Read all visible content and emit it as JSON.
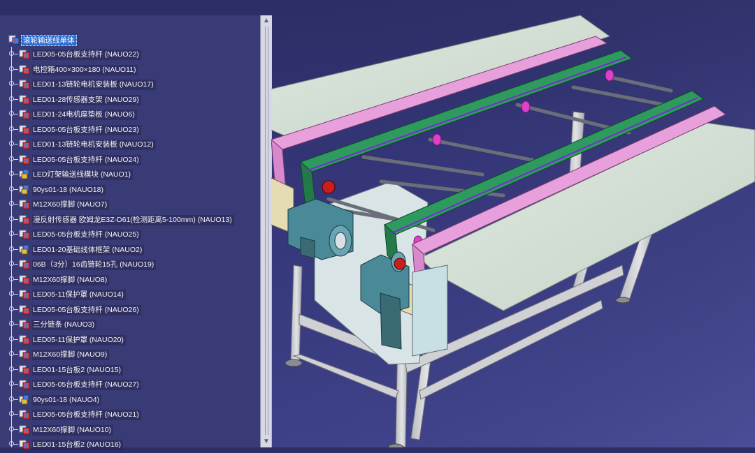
{
  "tree": {
    "root": {
      "label": "滚轮输送线单体",
      "icon": "product-icon"
    },
    "items": [
      {
        "label": "LED05-05台板支持杆 (NAUO22)",
        "icon": "part-icon"
      },
      {
        "label": "电控箱400×300×180 (NAUO11)",
        "icon": "part-icon"
      },
      {
        "label": "LED01-13链轮电机安装板 (NAUO17)",
        "icon": "part-icon"
      },
      {
        "label": "LED01-28传感器支架 (NAUO29)",
        "icon": "part-icon"
      },
      {
        "label": "LED01-24电机座垫板 (NAUO6)",
        "icon": "part-icon"
      },
      {
        "label": "LED05-05台板支持杆 (NAUO23)",
        "icon": "part-icon"
      },
      {
        "label": "LED01-13链轮电机安装板 (NAUO12)",
        "icon": "part-icon"
      },
      {
        "label": "LED05-05台板支持杆 (NAUO24)",
        "icon": "part-icon"
      },
      {
        "label": "LED灯架输送线模块 (NAUO1)",
        "icon": "assembly-icon"
      },
      {
        "label": "90ys01-18 (NAUO18)",
        "icon": "assembly-icon"
      },
      {
        "label": "M12X60撑脚 (NAUO7)",
        "icon": "part-icon"
      },
      {
        "label": "漫反射传感器 欧姆龙E3Z-D61(检测距离5-100mm) (NAUO13)",
        "icon": "part-icon"
      },
      {
        "label": "LED05-05台板支持杆 (NAUO25)",
        "icon": "part-icon"
      },
      {
        "label": "LED01-20基础线体框架 (NAUO2)",
        "icon": "assembly-icon"
      },
      {
        "label": "06B（3分）16齿链轮15孔 (NAUO19)",
        "icon": "part-icon"
      },
      {
        "label": "M12X60撑脚 (NAUO8)",
        "icon": "part-icon"
      },
      {
        "label": "LED05-11保护罩 (NAUO14)",
        "icon": "part-icon"
      },
      {
        "label": "LED05-05台板支持杆 (NAUO26)",
        "icon": "part-icon"
      },
      {
        "label": "三分链条 (NAUO3)",
        "icon": "part-icon"
      },
      {
        "label": "LED05-11保护罩 (NAUO20)",
        "icon": "part-icon"
      },
      {
        "label": "M12X60撑脚 (NAUO9)",
        "icon": "part-icon"
      },
      {
        "label": "LED01-15台板2 (NAUO15)",
        "icon": "part-icon"
      },
      {
        "label": "LED05-05台板支持杆 (NAUO27)",
        "icon": "part-icon"
      },
      {
        "label": "90ys01-18 (NAUO4)",
        "icon": "assembly-icon"
      },
      {
        "label": "LED05-05台板支持杆 (NAUO21)",
        "icon": "part-icon"
      },
      {
        "label": "M12X60撑脚 (NAUO10)",
        "icon": "part-icon"
      },
      {
        "label": "LED01-15台板2 (NAUO16)",
        "icon": "part-icon"
      }
    ]
  },
  "colors": {
    "background": "#34367a",
    "panel": "#393b76",
    "selection": "#2f6fd0",
    "plate": "#d6e2d8",
    "pink_rail": "#e8a0dc",
    "green_rail": "#2e9a5e",
    "frame": "#c8cacc",
    "motor": "#4a8a98"
  }
}
